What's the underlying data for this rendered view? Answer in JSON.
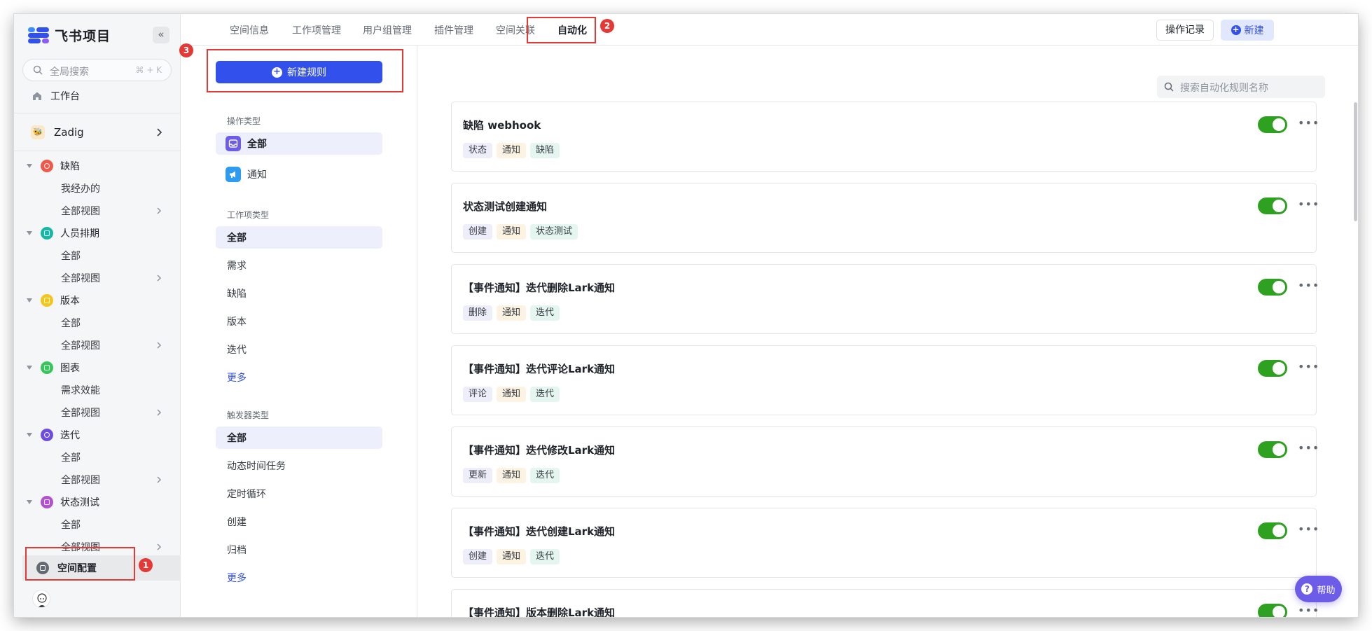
{
  "app": {
    "title": "飞书项目"
  },
  "sidebar": {
    "search": {
      "placeholder": "全局搜索",
      "shortcut": "⌘ + K"
    },
    "workbench": "工作台",
    "project": "Zadig",
    "groups": [
      {
        "label": "缺陷",
        "color": "#f0584a",
        "items": [
          "我经办的",
          "全部视图"
        ]
      },
      {
        "label": "人员排期",
        "color": "#14b8a6",
        "items": [
          "全部",
          "全部视图"
        ]
      },
      {
        "label": "版本",
        "color": "#f5c518",
        "items": [
          "全部",
          "全部视图"
        ]
      },
      {
        "label": "图表",
        "color": "#34c759",
        "items": [
          "需求效能",
          "全部视图"
        ]
      },
      {
        "label": "迭代",
        "color": "#6d4ee0",
        "items": [
          "全部",
          "全部视图"
        ]
      },
      {
        "label": "状态测试",
        "color": "#b34fd1",
        "items": [
          "全部",
          "全部视图"
        ]
      }
    ],
    "space_config": "空间配置"
  },
  "tabs": [
    "空间信息",
    "工作项管理",
    "用户组管理",
    "插件管理",
    "空间关联",
    "自动化"
  ],
  "active_tab": "自动化",
  "actions": {
    "log": "操作记录",
    "new": "新建"
  },
  "filters": {
    "new_rule": "新建规则",
    "op_type": {
      "heading": "操作类型",
      "items": [
        "全部",
        "通知"
      ]
    },
    "item_type": {
      "heading": "工作项类型",
      "items": [
        "全部",
        "需求",
        "缺陷",
        "版本",
        "迭代"
      ],
      "more": "更多"
    },
    "trigger_type": {
      "heading": "触发器类型",
      "items": [
        "全部",
        "动态时间任务",
        "定时循环",
        "创建",
        "归档"
      ],
      "more": "更多"
    }
  },
  "rules_search_placeholder": "搜索自动化规则名称",
  "rules": [
    {
      "title": "缺陷 webhook",
      "tags": [
        "状态",
        "通知",
        "缺陷"
      ],
      "enabled": true
    },
    {
      "title": "状态测试创建通知",
      "tags": [
        "创建",
        "通知",
        "状态测试"
      ],
      "enabled": true
    },
    {
      "title": "【事件通知】迭代删除Lark通知",
      "tags": [
        "删除",
        "通知",
        "迭代"
      ],
      "enabled": true
    },
    {
      "title": "【事件通知】迭代评论Lark通知",
      "tags": [
        "评论",
        "通知",
        "迭代"
      ],
      "enabled": true
    },
    {
      "title": "【事件通知】迭代修改Lark通知",
      "tags": [
        "更新",
        "通知",
        "迭代"
      ],
      "enabled": true
    },
    {
      "title": "【事件通知】迭代创建Lark通知",
      "tags": [
        "创建",
        "通知",
        "迭代"
      ],
      "enabled": true
    },
    {
      "title": "【事件通知】版本删除Lark通知",
      "tags": [],
      "enabled": true
    }
  ],
  "tag_colors": {
    "action": "#eeedfa",
    "notify": "#fdf3e2",
    "type": "#e4f6ef"
  },
  "help": "帮助",
  "annotations": [
    "1",
    "2",
    "3"
  ],
  "icons": [
    "search-icon",
    "home-icon",
    "chevron-right-icon",
    "collapse-icon",
    "plus-icon",
    "more-icon",
    "help-icon",
    "megaphone-icon",
    "inbox-icon"
  ]
}
